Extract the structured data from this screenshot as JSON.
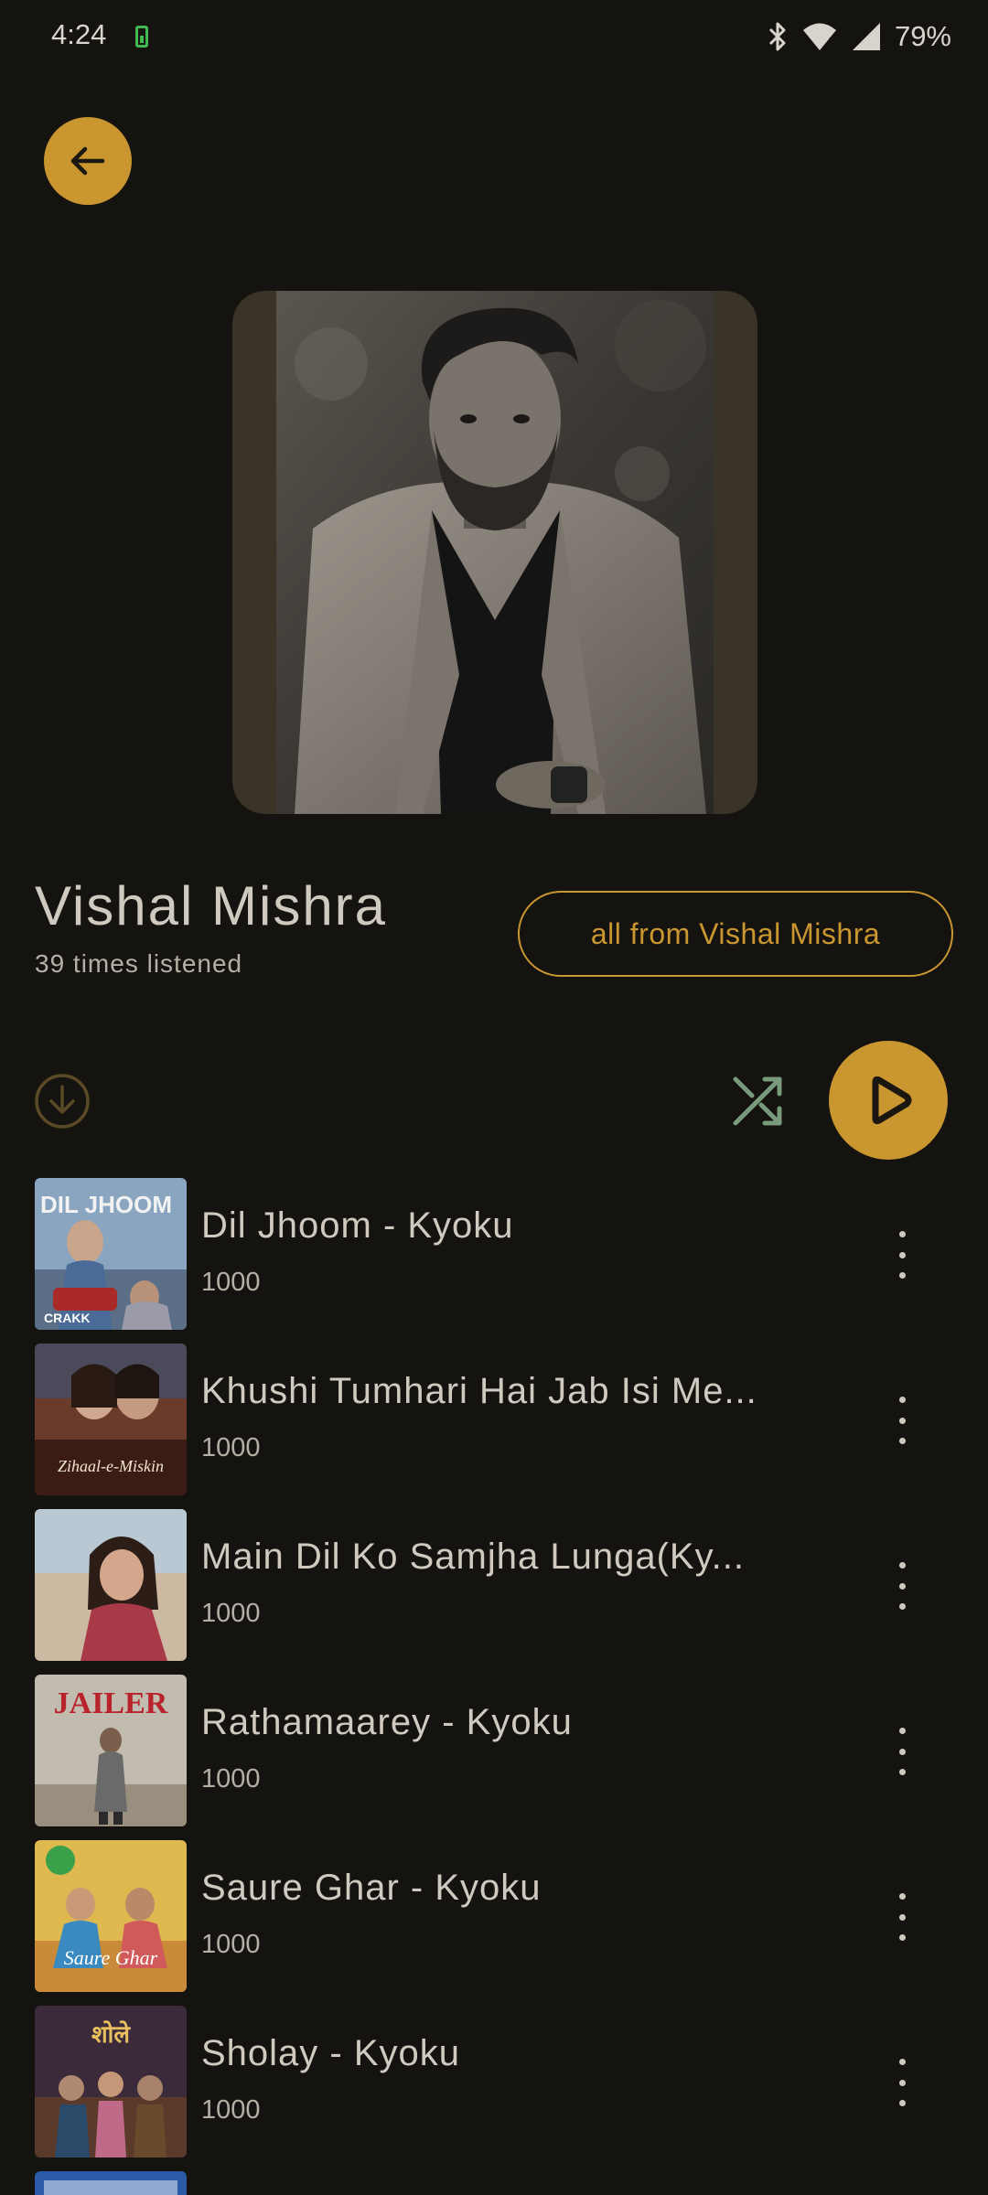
{
  "status": {
    "time": "4:24",
    "battery_percent": "79%"
  },
  "artist": {
    "name": "Vishal Mishra",
    "listen_count": "39 times listened",
    "all_from_label": "all from Vishal Mishra"
  },
  "colors": {
    "accent": "#c9962f",
    "background": "#151310",
    "text": "#cfc9bf",
    "shuffle": "#7a9a7c"
  },
  "icons": {
    "back": "arrow-left-icon",
    "download": "download-circle-icon",
    "shuffle": "shuffle-icon",
    "play": "play-icon",
    "menu": "more-vertical-icon"
  },
  "tracks": [
    {
      "title": "Dil Jhoom - Kyoku",
      "count": "1000",
      "thumb_text": "DIL JHOOM"
    },
    {
      "title": "Khushi Tumhari Hai Jab Isi Me...",
      "count": "1000",
      "thumb_text": "Zihaal-e-Miskin"
    },
    {
      "title": "Main Dil Ko Samjha Lunga(Ky...",
      "count": "1000",
      "thumb_text": ""
    },
    {
      "title": "Rathamaarey - Kyoku",
      "count": "1000",
      "thumb_text": "JAILER"
    },
    {
      "title": "Saure Ghar - Kyoku",
      "count": "1000",
      "thumb_text": "Saure Ghar"
    },
    {
      "title": "Sholay - Kyoku",
      "count": "1000",
      "thumb_text": "शोले"
    }
  ]
}
